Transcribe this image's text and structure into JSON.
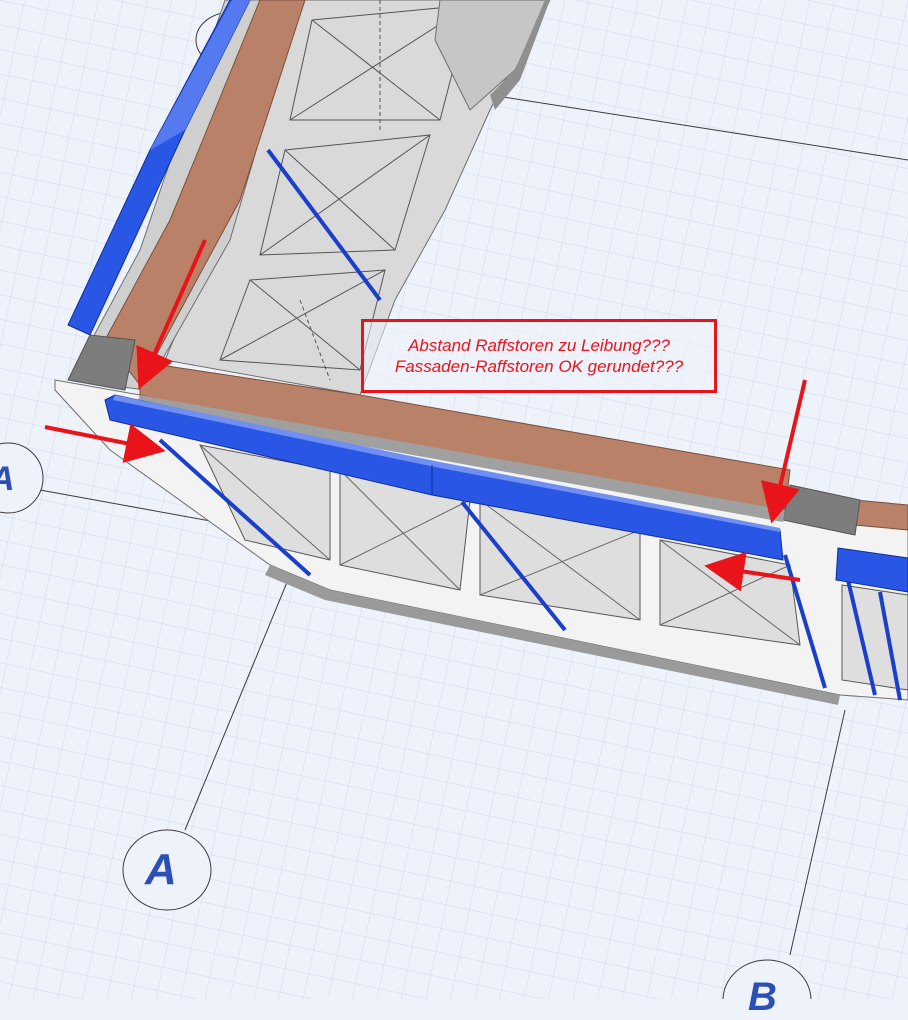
{
  "annotation": {
    "line1": "Abstand Raffstoren zu Leibung???",
    "line2": "Fassaden-Raffstoren OK gerundet???"
  },
  "grid_axes": [
    {
      "id": "axis-a-left",
      "label": "A"
    },
    {
      "id": "axis-a-bottom",
      "label": "A"
    },
    {
      "id": "axis-b-bottom",
      "label": "B"
    }
  ],
  "colors": {
    "background": "#eef2fb",
    "grid_line": "#c9d3ec",
    "blind_blue": "#2a56e6",
    "brick": "#b98268",
    "annotation_red": "#e8141a",
    "frame_grey": "#b4b4b4",
    "wall_white": "#f5f5f5"
  }
}
